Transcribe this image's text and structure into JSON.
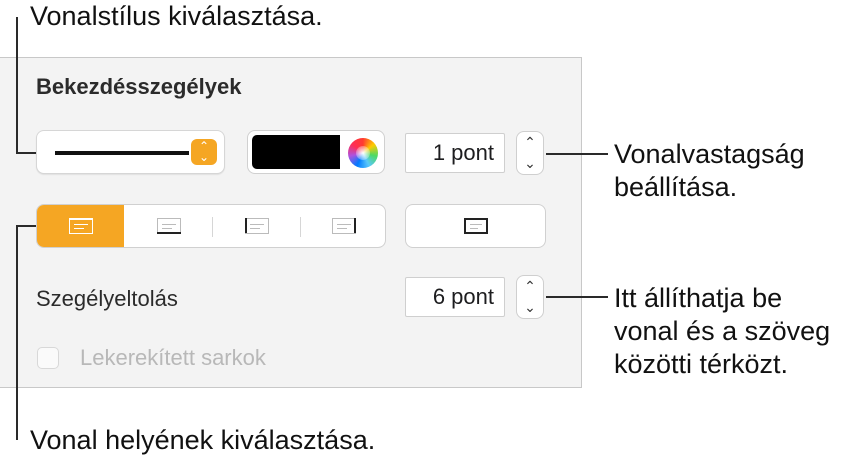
{
  "annotations": {
    "line_style": "Vonalstílus kiválasztása.",
    "line_width": [
      "Vonalvastagság",
      "beállítása."
    ],
    "spacing": [
      "Itt állíthatja be",
      "vonal és a szöveg",
      "közötti térközt."
    ],
    "position": "Vonal helyének kiválasztása."
  },
  "panel": {
    "title": "Bekezdésszegélyek",
    "stroke_style": "solid",
    "color_fill": "#000000",
    "accent_color": "#f5a623",
    "width_value": "1 pont",
    "position_segments": [
      "top",
      "bottom",
      "left",
      "right"
    ],
    "selected_segment": "top",
    "outline_button": "box",
    "offset_label": "Szegélyeltolás",
    "offset_value": "6 pont",
    "rounded_label": "Lekerekített sarkok",
    "rounded_checked": false,
    "rounded_enabled": false
  },
  "icons": {
    "stepper_up": "chevron-up-icon",
    "stepper_down": "chevron-down-icon",
    "popup_arrows": "up-down-chevron-icon",
    "color_wheel": "color-wheel-icon"
  }
}
